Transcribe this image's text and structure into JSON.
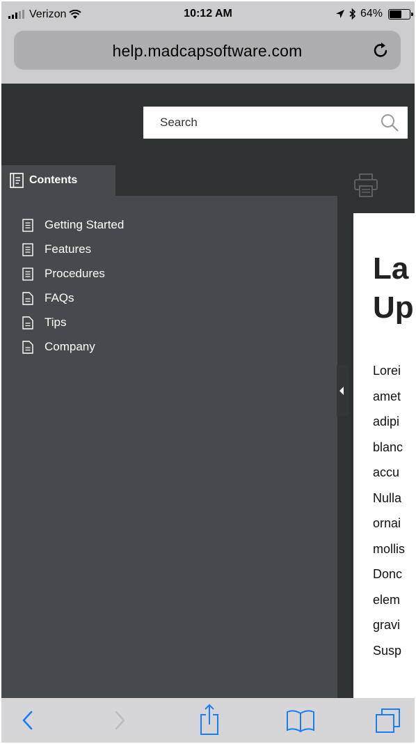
{
  "status_bar": {
    "carrier": "Verizon",
    "time": "10:12 AM",
    "battery": "64%",
    "battery_level": 0.64
  },
  "browser": {
    "url": "help.madcapsoftware.com"
  },
  "site": {
    "search": {
      "placeholder": "Search"
    },
    "toc": {
      "tab_label": "Contents",
      "items": [
        {
          "label": "Getting Started",
          "icon": "book-icon"
        },
        {
          "label": "Features",
          "icon": "book-icon"
        },
        {
          "label": "Procedures",
          "icon": "book-icon"
        },
        {
          "label": "FAQs",
          "icon": "page-icon"
        },
        {
          "label": "Tips",
          "icon": "page-icon"
        },
        {
          "label": "Company",
          "icon": "page-icon"
        }
      ]
    },
    "content": {
      "title_lines": [
        "La",
        "Up"
      ],
      "body_lines": [
        "Lorei",
        "amet",
        "adipi",
        "blanc",
        "accu",
        "Nulla",
        "ornai",
        "mollis",
        "Donc",
        "elem",
        "gravi",
        "Susp"
      ]
    }
  },
  "toolbar": {
    "icons": [
      "back-icon",
      "forward-icon",
      "share-icon",
      "bookmarks-icon",
      "tabs-icon"
    ]
  },
  "colors": {
    "header_bg": "#2e3233",
    "panel_bg": "#464a4d",
    "ios_blue": "#1a7cf6"
  }
}
